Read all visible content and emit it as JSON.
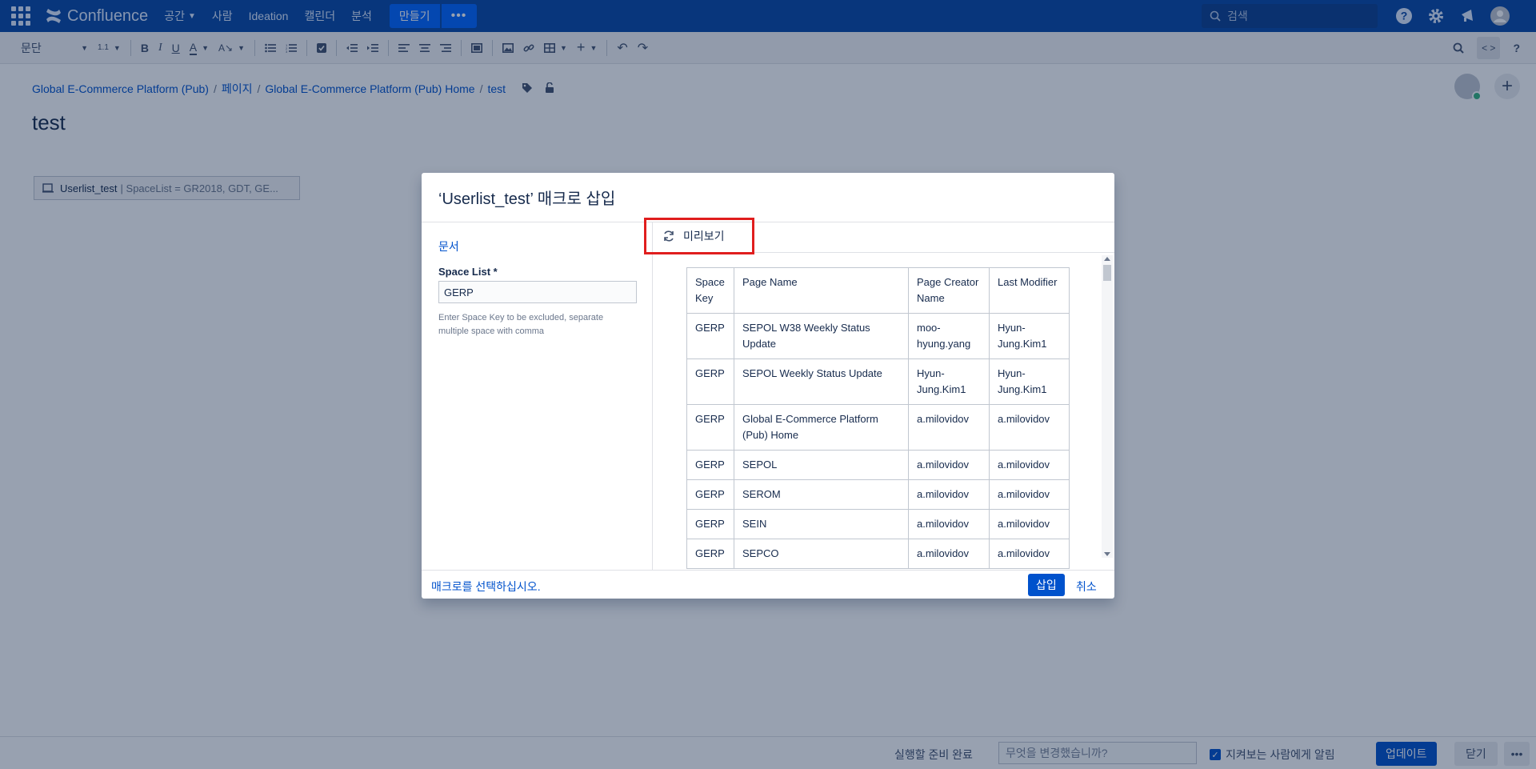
{
  "topnav": {
    "brand": "Confluence",
    "items": [
      {
        "label": "공간",
        "has_dropdown": true
      },
      {
        "label": "사람"
      },
      {
        "label": "Ideation"
      },
      {
        "label": "캘린더"
      },
      {
        "label": "분석"
      }
    ],
    "create_label": "만들기",
    "more_label": "•••",
    "search_placeholder": "검색"
  },
  "toolbar": {
    "paragraph_label": "문단",
    "line_spacing_label": "1.1"
  },
  "breadcrumb": [
    "Global E-Commerce Platform (Pub)",
    "페이지",
    "Global E-Commerce Platform (Pub) Home",
    "test"
  ],
  "page": {
    "title": "test",
    "macro_placeholder": {
      "name": "Userlist_test",
      "meta": "| SpaceList = GR2018, GDT, GE..."
    }
  },
  "dialog": {
    "title": "‘Userlist_test’ 매크로 삽입",
    "left": {
      "doc_link": "문서",
      "field_label": "Space List *",
      "field_value": "GERP",
      "hint": "Enter Space Key to be excluded, separate multiple space with comma"
    },
    "preview_label": "미리보기",
    "table": {
      "headers": [
        "Space Key",
        "Page Name",
        "Page Creator Name",
        "Last Modifier"
      ],
      "rows": [
        [
          "GERP",
          "SEPOL W38 Weekly Status Update",
          "moo-hyung.yang",
          "Hyun-Jung.Kim1"
        ],
        [
          "GERP",
          "SEPOL Weekly Status Update",
          "Hyun-Jung.Kim1",
          "Hyun-Jung.Kim1"
        ],
        [
          "GERP",
          "Global E-Commerce Platform (Pub) Home",
          "a.milovidov",
          "a.milovidov"
        ],
        [
          "GERP",
          "SEPOL",
          "a.milovidov",
          "a.milovidov"
        ],
        [
          "GERP",
          "SEROM",
          "a.milovidov",
          "a.milovidov"
        ],
        [
          "GERP",
          "SEIN",
          "a.milovidov",
          "a.milovidov"
        ],
        [
          "GERP",
          "SEPCO",
          "a.milovidov",
          "a.milovidov"
        ]
      ]
    },
    "footer": {
      "select_msg": "매크로를 선택하십시오.",
      "insert_label": "삽입",
      "cancel_label": "취소"
    }
  },
  "bottombar": {
    "status": "실행할 준비 완료",
    "comment_placeholder": "무엇을 변경했습니까?",
    "notify_label": "지켜보는 사람에게 알림",
    "update_label": "업데이트",
    "close_label": "닫기",
    "more_label": "•••"
  },
  "colors": {
    "nav_bg": "#0747a6",
    "primary": "#0052cc",
    "highlight_border": "#e01e1e"
  }
}
